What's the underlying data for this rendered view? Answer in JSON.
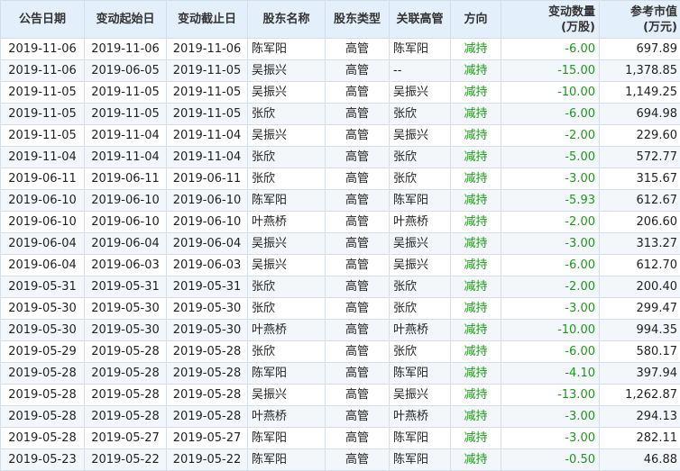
{
  "columns": [
    "公告日期",
    "变动起始日",
    "变动截止日",
    "股东名称",
    "股东类型",
    "关联高管",
    "方向",
    "变动数量\n(万股)",
    "参考市值\n(万元)"
  ],
  "rows": [
    [
      "2019-11-06",
      "2019-11-06",
      "2019-11-06",
      "陈军阳",
      "高管",
      "陈军阳",
      "减持",
      "-6.00",
      "697.89"
    ],
    [
      "2019-11-06",
      "2019-06-05",
      "2019-11-05",
      "吴振兴",
      "高管",
      "--",
      "减持",
      "-15.00",
      "1,378.85"
    ],
    [
      "2019-11-05",
      "2019-11-05",
      "2019-11-05",
      "吴振兴",
      "高管",
      "吴振兴",
      "减持",
      "-10.00",
      "1,149.25"
    ],
    [
      "2019-11-05",
      "2019-11-05",
      "2019-11-05",
      "张欣",
      "高管",
      "张欣",
      "减持",
      "-6.00",
      "694.98"
    ],
    [
      "2019-11-05",
      "2019-11-04",
      "2019-11-04",
      "吴振兴",
      "高管",
      "吴振兴",
      "减持",
      "-2.00",
      "229.60"
    ],
    [
      "2019-11-04",
      "2019-11-04",
      "2019-11-04",
      "张欣",
      "高管",
      "张欣",
      "减持",
      "-5.00",
      "572.77"
    ],
    [
      "2019-06-11",
      "2019-06-11",
      "2019-06-11",
      "张欣",
      "高管",
      "张欣",
      "减持",
      "-3.00",
      "315.67"
    ],
    [
      "2019-06-10",
      "2019-06-10",
      "2019-06-10",
      "陈军阳",
      "高管",
      "陈军阳",
      "减持",
      "-5.93",
      "612.67"
    ],
    [
      "2019-06-10",
      "2019-06-10",
      "2019-06-10",
      "叶燕桥",
      "高管",
      "叶燕桥",
      "减持",
      "-2.00",
      "206.60"
    ],
    [
      "2019-06-04",
      "2019-06-04",
      "2019-06-04",
      "吴振兴",
      "高管",
      "吴振兴",
      "减持",
      "-3.00",
      "313.27"
    ],
    [
      "2019-06-04",
      "2019-06-03",
      "2019-06-03",
      "吴振兴",
      "高管",
      "吴振兴",
      "减持",
      "-6.00",
      "612.70"
    ],
    [
      "2019-05-31",
      "2019-05-31",
      "2019-05-31",
      "张欣",
      "高管",
      "张欣",
      "减持",
      "-2.00",
      "200.40"
    ],
    [
      "2019-05-30",
      "2019-05-30",
      "2019-05-30",
      "张欣",
      "高管",
      "张欣",
      "减持",
      "-3.00",
      "299.47"
    ],
    [
      "2019-05-30",
      "2019-05-30",
      "2019-05-30",
      "叶燕桥",
      "高管",
      "叶燕桥",
      "减持",
      "-10.00",
      "994.35"
    ],
    [
      "2019-05-29",
      "2019-05-28",
      "2019-05-28",
      "张欣",
      "高管",
      "张欣",
      "减持",
      "-6.00",
      "580.17"
    ],
    [
      "2019-05-28",
      "2019-05-28",
      "2019-05-28",
      "陈军阳",
      "高管",
      "陈军阳",
      "减持",
      "-4.10",
      "397.94"
    ],
    [
      "2019-05-28",
      "2019-05-28",
      "2019-05-28",
      "吴振兴",
      "高管",
      "吴振兴",
      "减持",
      "-13.00",
      "1,262.87"
    ],
    [
      "2019-05-28",
      "2019-05-28",
      "2019-05-28",
      "叶燕桥",
      "高管",
      "叶燕桥",
      "减持",
      "-3.00",
      "294.13"
    ],
    [
      "2019-05-28",
      "2019-05-27",
      "2019-05-27",
      "陈军阳",
      "高管",
      "陈军阳",
      "减持",
      "-3.00",
      "282.11"
    ],
    [
      "2019-05-23",
      "2019-05-22",
      "2019-05-22",
      "陈军阳",
      "高管",
      "陈军阳",
      "减持",
      "-0.50",
      "46.88"
    ]
  ],
  "colors": {
    "header_bg": "#e3effa",
    "grid_line": "#d4dde8",
    "stripe_bg": "#f3f7fb",
    "decrease_green": "#1a9a1a"
  }
}
